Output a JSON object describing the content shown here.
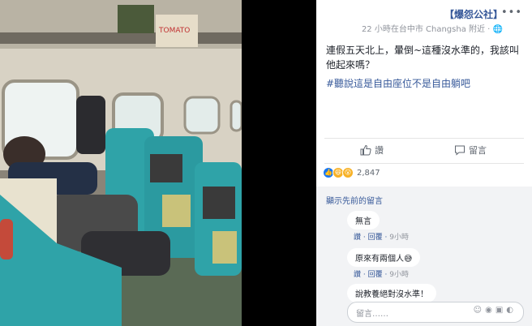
{
  "post": {
    "page_name": "【爆怨公社】",
    "meta": "22 小時在台中市 Changsha 附近 · 🌐",
    "text": "連假五天北上，暈倒~這種沒水準的，我該叫他起來嗎？",
    "hashtag": "#聽說這是自由座位不是自由躺吧",
    "photo_box_text": "TOMATO"
  },
  "actions": {
    "like": "讚",
    "comment": "留言"
  },
  "reactions": {
    "count": "2,847"
  },
  "comments": {
    "view_previous": "顯示先前的留言",
    "items": [
      {
        "text": "無言",
        "like": "讚",
        "reply": "回覆",
        "time": "9小時"
      },
      {
        "text": "原來有兩個人😅",
        "like": "讚",
        "reply": "回覆",
        "time": "9小時"
      },
      {
        "text": "說教養絕對沒水準！"
      }
    ],
    "input_placeholder": "留言……"
  },
  "colors": {
    "link": "#365899",
    "seat_teal": "#2fa3a8",
    "panel_bg": "#ffffff"
  }
}
